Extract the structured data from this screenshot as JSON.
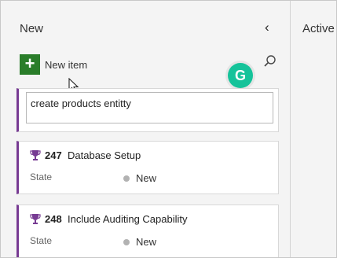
{
  "columns": {
    "new": {
      "title": "New"
    },
    "active": {
      "title": "Active"
    }
  },
  "toolbar": {
    "add_icon": "plus-icon",
    "new_item_label": "New item"
  },
  "new_card": {
    "input_value": "create products entitty"
  },
  "cards": [
    {
      "id": "247",
      "title": "Database Setup",
      "field_label": "State",
      "state": "New"
    },
    {
      "id": "248",
      "title": "Include Auditing Capability",
      "field_label": "State",
      "state": "New"
    }
  ],
  "colors": {
    "accent": "#773b93",
    "add_button": "#2a7d2a",
    "grammarly": "#15c39a",
    "state_dot": "#b2b2b2"
  }
}
